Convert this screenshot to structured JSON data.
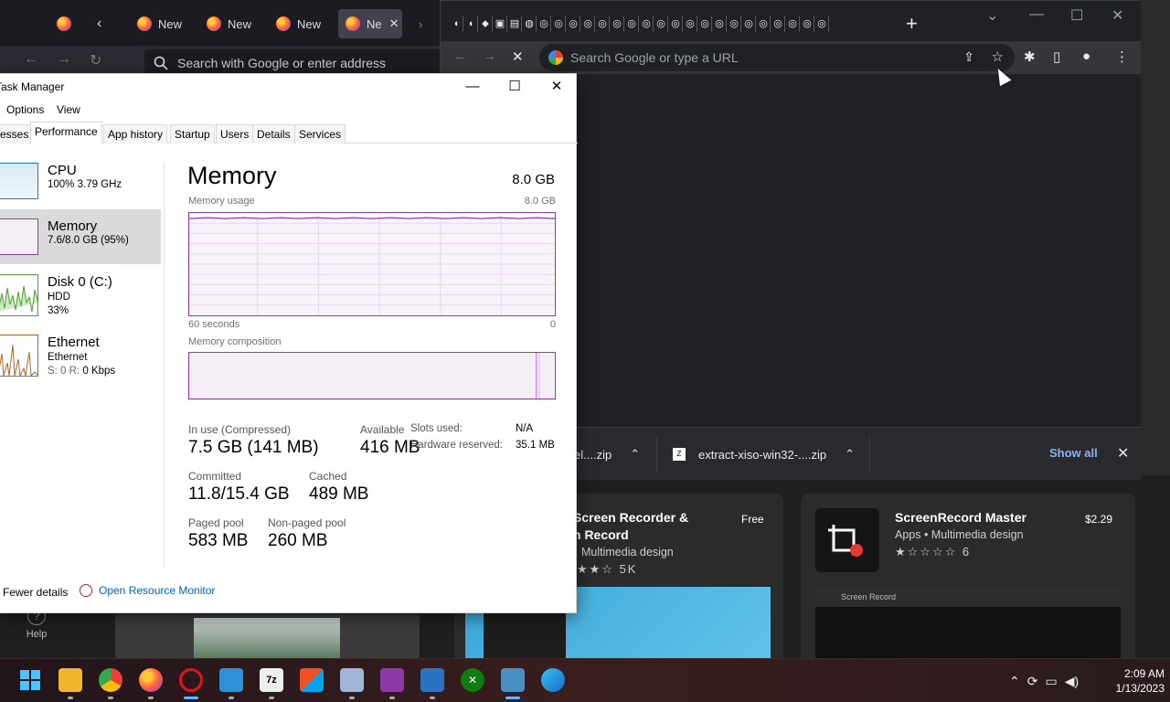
{
  "firefox": {
    "tabs": [
      {
        "label": "New"
      },
      {
        "label": "New"
      },
      {
        "label": "New"
      },
      {
        "label": "Ne"
      }
    ],
    "address_placeholder": "Search with Google or enter address"
  },
  "chrome": {
    "omnibox_placeholder": "Search Google or type a URL",
    "downloads": [
      {
        "name": "el....zip"
      },
      {
        "name": "extract-xiso-win32-....zip"
      }
    ],
    "show_all": "Show all"
  },
  "taskmgr": {
    "title": "Task Manager",
    "menu": [
      "Options",
      "View"
    ],
    "tabs": [
      "esses",
      "Performance",
      "App history",
      "Startup",
      "Users",
      "Details",
      "Services"
    ],
    "sidebar": {
      "cpu": {
        "name": "CPU",
        "sub": "100%  3.79 GHz"
      },
      "memory": {
        "name": "Memory",
        "sub": "7.6/8.0 GB (95%)"
      },
      "disk": {
        "name": "Disk 0 (C:)",
        "sub1": "HDD",
        "sub2": "33%"
      },
      "ethernet": {
        "name": "Ethernet",
        "sub1": "Ethernet",
        "sub2_prefix": "S: 0  R: ",
        "sub2_value": "0 Kbps"
      }
    },
    "main": {
      "heading": "Memory",
      "total": "8.0 GB",
      "usage_label": "Memory usage",
      "usage_max": "8.0 GB",
      "time_left": "60 seconds",
      "time_right": "0",
      "composition_label": "Memory composition",
      "in_use_label": "In use (Compressed)",
      "in_use_value": "7.5 GB (141 MB)",
      "available_label": "Available",
      "available_value": "416 MB",
      "slots_label": "Slots used:",
      "slots_value": "N/A",
      "hw_label": "Hardware reserved:",
      "hw_value": "35.1 MB",
      "committed_label": "Committed",
      "committed_value": "11.8/15.4 GB",
      "cached_label": "Cached",
      "cached_value": "489 MB",
      "paged_label": "Paged pool",
      "paged_value": "583 MB",
      "nonpaged_label": "Non-paged pool",
      "nonpaged_value": "260 MB",
      "memory_usage_fraction": 0.95
    },
    "footer": {
      "fewer_details": "Fewer details",
      "open_resource_monitor": "Open Resource Monitor"
    }
  },
  "store": {
    "card1": {
      "title_line1": "Screen Recorder &",
      "title_line2": "n Record",
      "meta": "Multimedia design",
      "rating_count": "5K",
      "price": "Free"
    },
    "card2": {
      "title": "ScreenRecord Master",
      "meta": "Apps • Multimedia design",
      "rating_count": "6",
      "price": "$2.29",
      "screenshot_title": "Screen Record"
    },
    "help": "Help"
  },
  "taskbar": {
    "clock_time": "2:09 AM",
    "clock_date": "1/13/2023"
  },
  "colors": {
    "memory_purple": "#8b3aa8",
    "taskmgr_selected": "#dadada",
    "chrome_link": "#8ab4f8"
  }
}
